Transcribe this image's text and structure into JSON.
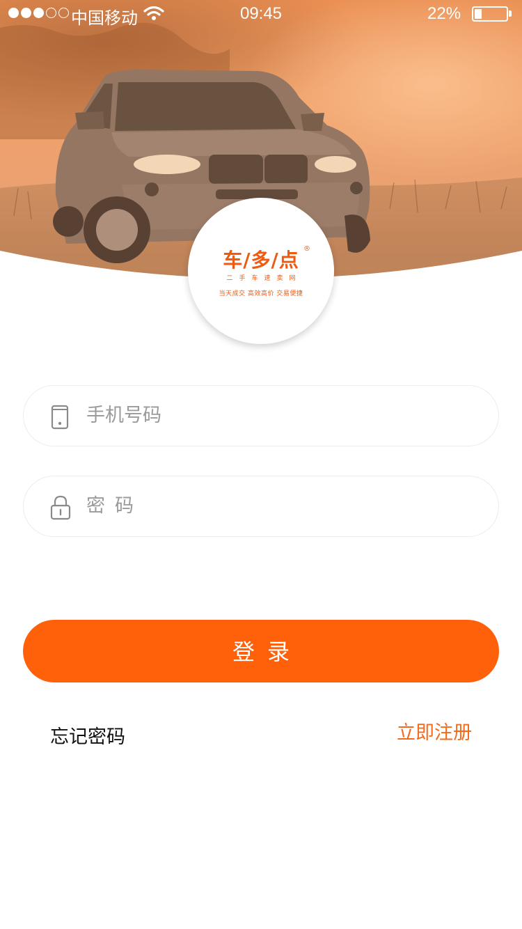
{
  "status_bar": {
    "signal_dots_filled": 3,
    "signal_dots_total": 5,
    "carrier": "中国移动",
    "time": "09:45",
    "battery_percent": "22%",
    "battery_level": 0.22
  },
  "logo": {
    "brand": "车/多/点",
    "registered_mark": "®",
    "subtitle": "二手车速卖网",
    "slogan": "当天成交 高效高价 交易便捷"
  },
  "form": {
    "phone": {
      "placeholder": "手机号码",
      "icon": "phone-icon"
    },
    "password": {
      "placeholder": "密码",
      "icon": "lock-icon"
    }
  },
  "login_button": "登录",
  "links": {
    "forgot_password": "忘记密码",
    "register": "立即注册"
  },
  "colors": {
    "accent": "#ff610b",
    "link": "#f26b1d",
    "hero_tint": "#e98a4e"
  }
}
